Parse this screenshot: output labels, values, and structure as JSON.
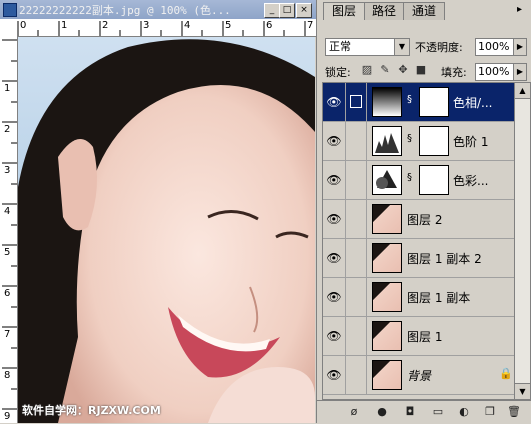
{
  "document": {
    "title": "22222222222副本.jpg @ 100% (色...",
    "minimize": "_",
    "maximize": "□",
    "close": "×",
    "ruler_top": [
      "0",
      "1",
      "2",
      "3",
      "4",
      "5",
      "6",
      "7"
    ],
    "ruler_left": [
      "1",
      "2",
      "3",
      "4",
      "5",
      "6",
      "7",
      "8",
      "9"
    ],
    "watermark": "软件自学网：RJZXW.COM"
  },
  "layers_panel": {
    "tabs": [
      "图层",
      "路径",
      "通道"
    ],
    "blend_mode": "正常",
    "opacity_label": "不透明度:",
    "opacity_value": "100%",
    "lock_label": "锁定:",
    "fill_label": "填充:",
    "fill_value": "100%",
    "layers": [
      {
        "name": "色相/...",
        "type": "adjustment",
        "selected": true
      },
      {
        "name": "色阶 1",
        "type": "adjustment",
        "selected": false
      },
      {
        "name": "色彩...",
        "type": "adjustment",
        "selected": false
      },
      {
        "name": "图层 2",
        "type": "image",
        "selected": false
      },
      {
        "name": "图层 1 副本 2",
        "type": "image",
        "selected": false
      },
      {
        "name": "图层 1 副本",
        "type": "image",
        "selected": false
      },
      {
        "name": "图层 1",
        "type": "image",
        "selected": false
      },
      {
        "name": "背景",
        "type": "background",
        "selected": false
      }
    ]
  },
  "colors": {
    "selected_layer": "#0a246a",
    "panel_bg": "#d4d0c8"
  }
}
